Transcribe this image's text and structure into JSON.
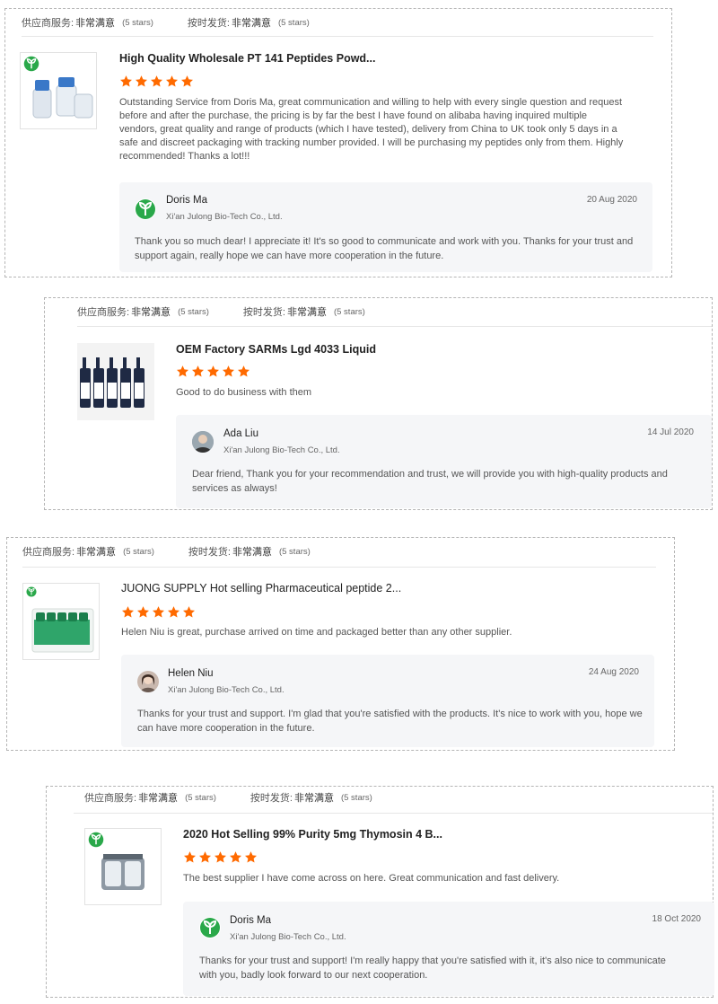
{
  "ratings": {
    "service_label": "供应商服务:",
    "service_value": "非常满意",
    "service_count": "(5 stars)",
    "shipping_label": "按时发货:",
    "shipping_value": "非常满意",
    "shipping_count": "(5 stars)"
  },
  "colors": {
    "star": "#ff6a00",
    "logo_green": "#2aa84a"
  },
  "reviews": [
    {
      "title": "High Quality Wholesale PT 141 Peptides Powd...",
      "stars": 5,
      "text": "Outstanding Service from Doris Ma, great communication and willing to help with every single question and request before and after the purchase, the pricing is by far the best I have found on alibaba having inquired multiple vendors, great quality and range of products (which I have tested), delivery from China to UK took only 5 days in a safe and discreet packaging with tracking number provided. I will be purchasing my peptides only from them. Highly recommended! Thanks a lot!!!",
      "reply": {
        "name": "Doris Ma",
        "company": "Xi'an Julong Bio-Tech Co., Ltd.",
        "date": "20 Aug 2020",
        "text": "Thank you so much dear!  I appreciate it! It's so good to communicate and work with you. Thanks for your trust and support again, really hope we can have more cooperation in the future."
      }
    },
    {
      "title": "OEM Factory SARMs Lgd 4033 Liquid",
      "stars": 5,
      "text": "Good to do business with them",
      "reply": {
        "name": "Ada Liu",
        "company": "Xi'an Julong Bio-Tech Co., Ltd.",
        "date": "14 Jul 2020",
        "text": "Dear friend, Thank you for your recommendation and trust, we will provide you with high-quality products and services as always!"
      }
    },
    {
      "title": "JUONG SUPPLY Hot selling Pharmaceutical peptide 2...",
      "stars": 5,
      "text": "Helen Niu is great, purchase arrived on time and packaged better than any other supplier.",
      "reply": {
        "name": "Helen Niu",
        "company": "Xi'an Julong Bio-Tech Co., Ltd.",
        "date": "24 Aug 2020",
        "text": "Thanks for your trust and support. I'm glad that you're satisfied with the products. It's nice to work with you, hope we can  have more cooperation in the future."
      }
    },
    {
      "title": "2020 Hot Selling 99% Purity 5mg Thymosin 4 B...",
      "stars": 5,
      "text": "The best supplier I have come across on here. Great communication and fast delivery.",
      "reply": {
        "name": "Doris Ma",
        "company": "Xi'an Julong Bio-Tech Co., Ltd.",
        "date": "18 Oct 2020",
        "text": "Thanks for your trust and support! I'm really happy that you're satisfied with it, it's also nice to communicate with you, badly look forward to our next cooperation."
      }
    }
  ]
}
